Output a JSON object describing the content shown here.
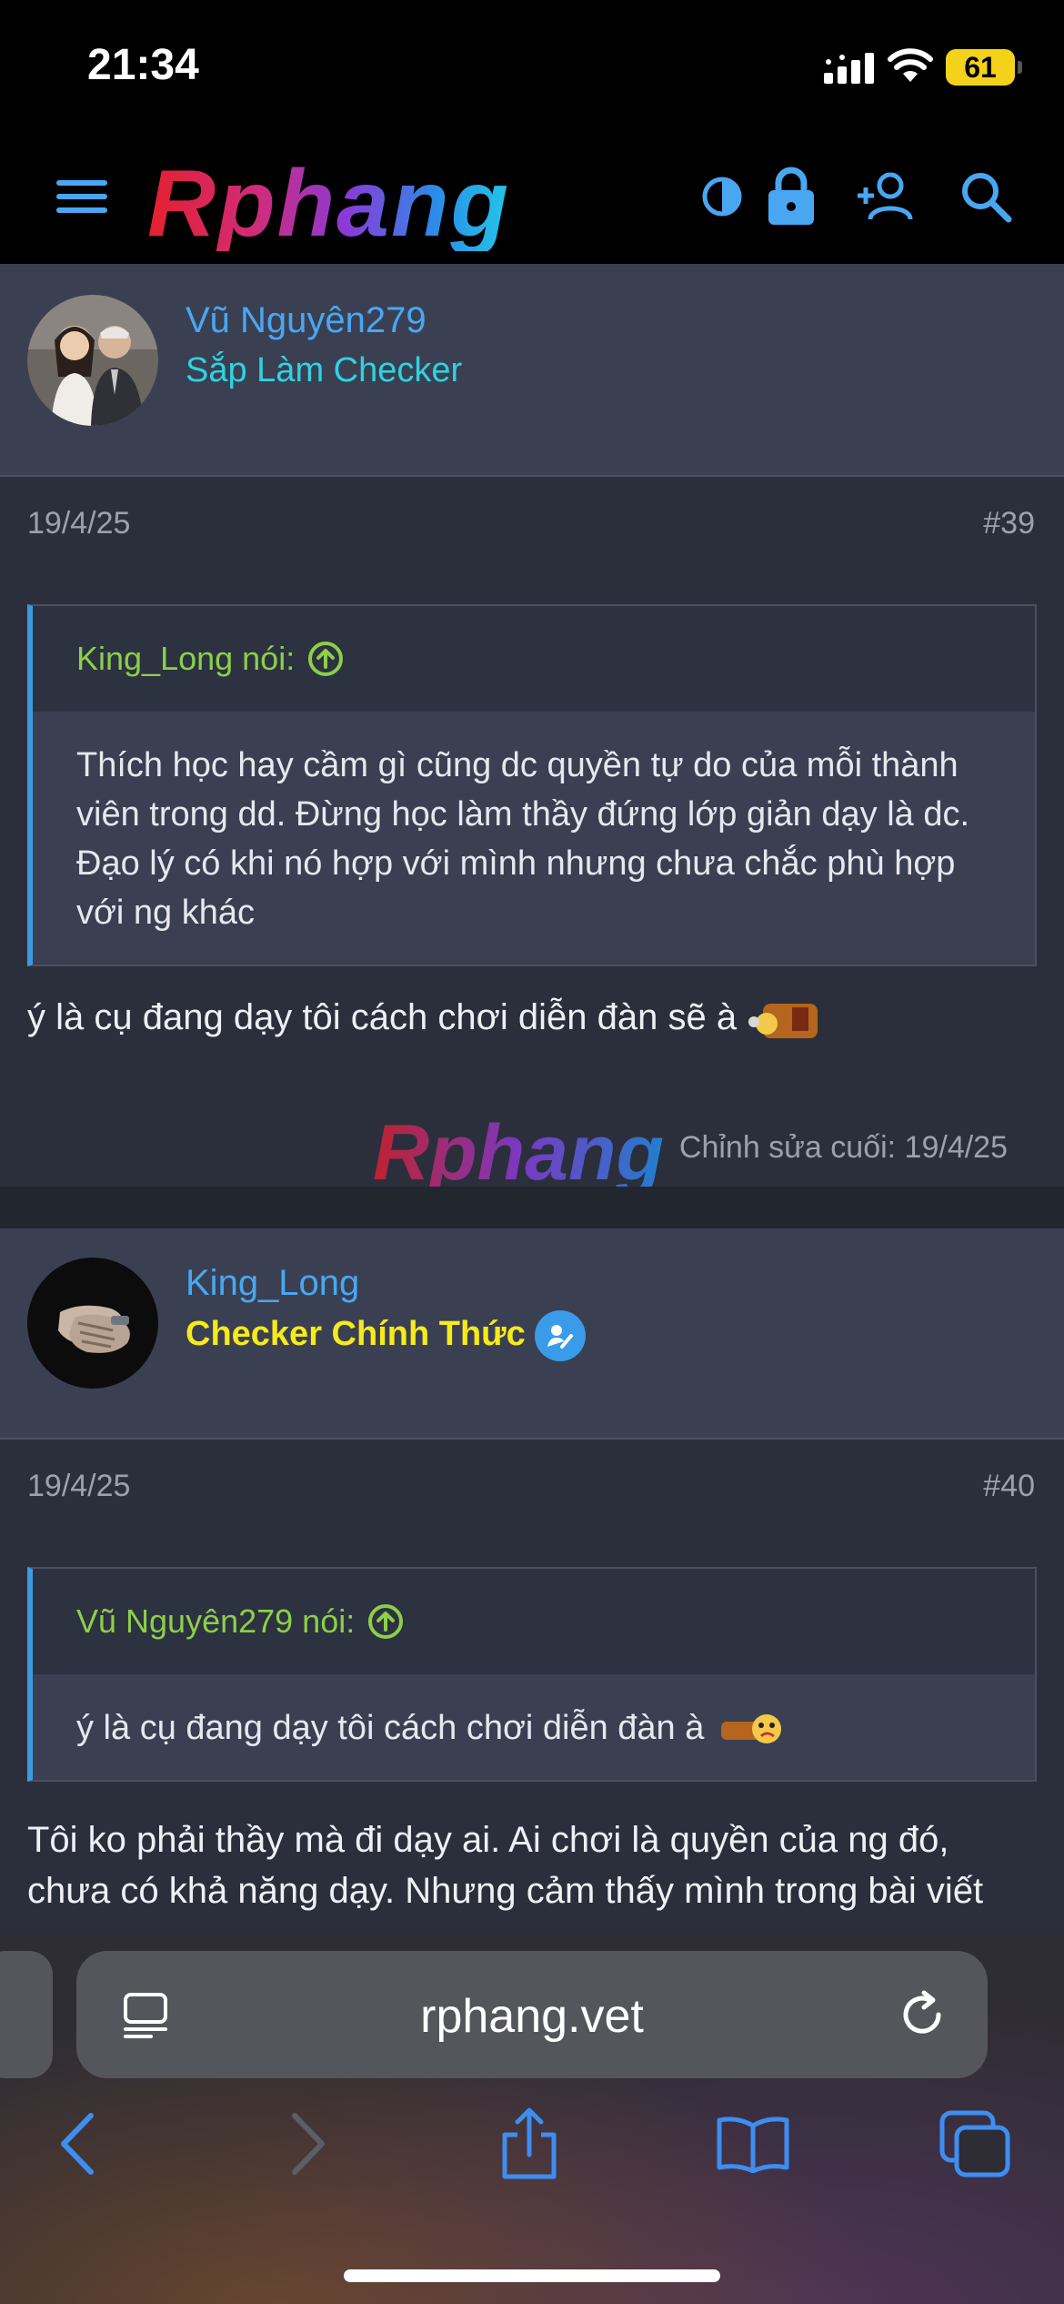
{
  "status": {
    "time": "21:34",
    "battery": "61"
  },
  "header": {
    "logo": "Rphang"
  },
  "post1": {
    "author": "Vũ Nguyên279",
    "title": "Sắp Làm Checker",
    "date": "19/4/25",
    "number": "#39",
    "quote_author": "King_Long nói:",
    "quote_text": "Thích học hay cầm gì cũng dc quyền tự do của mỗi thành viên trong dd. Đừng học làm thầy đứng lớp giản dạy là dc. Đạo lý có khi nó hợp với mình nhưng chưa chắc phù hợp với ng khác",
    "message": "ý là cụ đang dạy tôi cách chơi diễn đàn sẽ à",
    "edited": "Chỉnh sửa cuối: 19/4/25"
  },
  "watermark": "Rphang",
  "post2": {
    "author": "King_Long",
    "title": "Checker Chính Thức",
    "date": "19/4/25",
    "number": "#40",
    "quote_author": "Vũ Nguyên279 nói:",
    "quote_text": "ý là cụ đang dạy tôi cách chơi diễn đàn à",
    "message": "Tôi ko phải thầy mà đi dạy ai. Ai chơi là quyền của ng đó, chưa có khả năng dạy. Nhưng cảm thấy mình trong bài viết"
  },
  "browser": {
    "url": "rphang.vet"
  },
  "colors": {
    "accent": "#49a7f2",
    "checker_title": "#2fd3e0",
    "official_title": "#f6ea1a",
    "quote_author": "#8ccf4a"
  }
}
